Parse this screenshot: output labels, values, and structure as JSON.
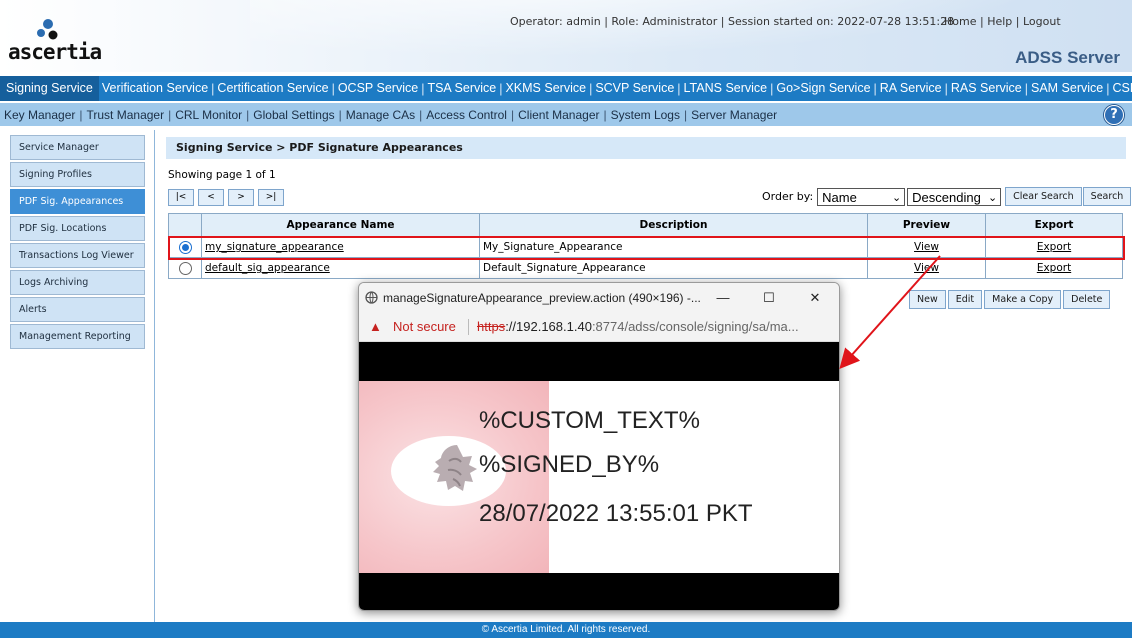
{
  "header": {
    "logo_text": "ascertia",
    "operator_info": "Operator: admin | Role: Administrator | Session started on: 2022-07-28 13:51:28",
    "links": [
      "Home",
      "Help",
      "Logout"
    ],
    "server_title": "ADSS Server"
  },
  "main_nav": [
    "Signing Service",
    "Verification Service",
    "Certification Service",
    "OCSP Service",
    "TSA Service",
    "XKMS Service",
    "SCVP Service",
    "LTANS Service",
    "Go>Sign Service",
    "RA Service",
    "RAS Service",
    "SAM Service",
    "CSP Service"
  ],
  "sub_nav": [
    "Key Manager",
    "Trust Manager",
    "CRL Monitor",
    "Global Settings",
    "Manage CAs",
    "Access Control",
    "Client Manager",
    "System Logs",
    "Server Manager"
  ],
  "help_icon": "?",
  "sidebar": [
    "Service Manager",
    "Signing Profiles",
    "PDF Sig. Appearances",
    "PDF Sig. Locations",
    "Transactions Log Viewer",
    "Logs Archiving",
    "Alerts",
    "Management Reporting"
  ],
  "breadcrumb": "Signing Service > PDF Signature Appearances",
  "showing": "Showing page 1 of 1",
  "pager": [
    "|<",
    "<",
    ">",
    ">|"
  ],
  "order_by": {
    "label": "Order by:",
    "field": "Name",
    "direction": "Descending",
    "clear_search": "Clear Search",
    "search": "Search"
  },
  "table": {
    "headers": [
      "Appearance Name",
      "Description",
      "Preview",
      "Export"
    ],
    "rows": [
      {
        "name": "my_signature_appearance",
        "description": "My_Signature_Appearance",
        "preview": "View",
        "export": "Export",
        "selected": true
      },
      {
        "name": "default_sig_appearance",
        "description": "Default_Signature_Appearance",
        "preview": "View",
        "export": "Export",
        "selected": false
      }
    ]
  },
  "actions": [
    "New",
    "Edit",
    "Make a Copy",
    "Delete"
  ],
  "popup": {
    "title": "manageSignatureAppearance_preview.action (490×196) -...",
    "not_secure": "Not secure",
    "url_https": "https",
    "url_host": "://192.168.1.40",
    "url_rest": ":8774/adss/console/signing/sa/ma...",
    "preview_lines": [
      "%CUSTOM_TEXT%",
      "%SIGNED_BY%",
      "28/07/2022 13:55:01 PKT"
    ]
  },
  "footer": "© Ascertia Limited. All rights reserved.",
  "colors": {
    "nav_blue": "#1d7bc4",
    "sub_nav": "#9ec8ea",
    "highlight_red": "#e0141a"
  }
}
